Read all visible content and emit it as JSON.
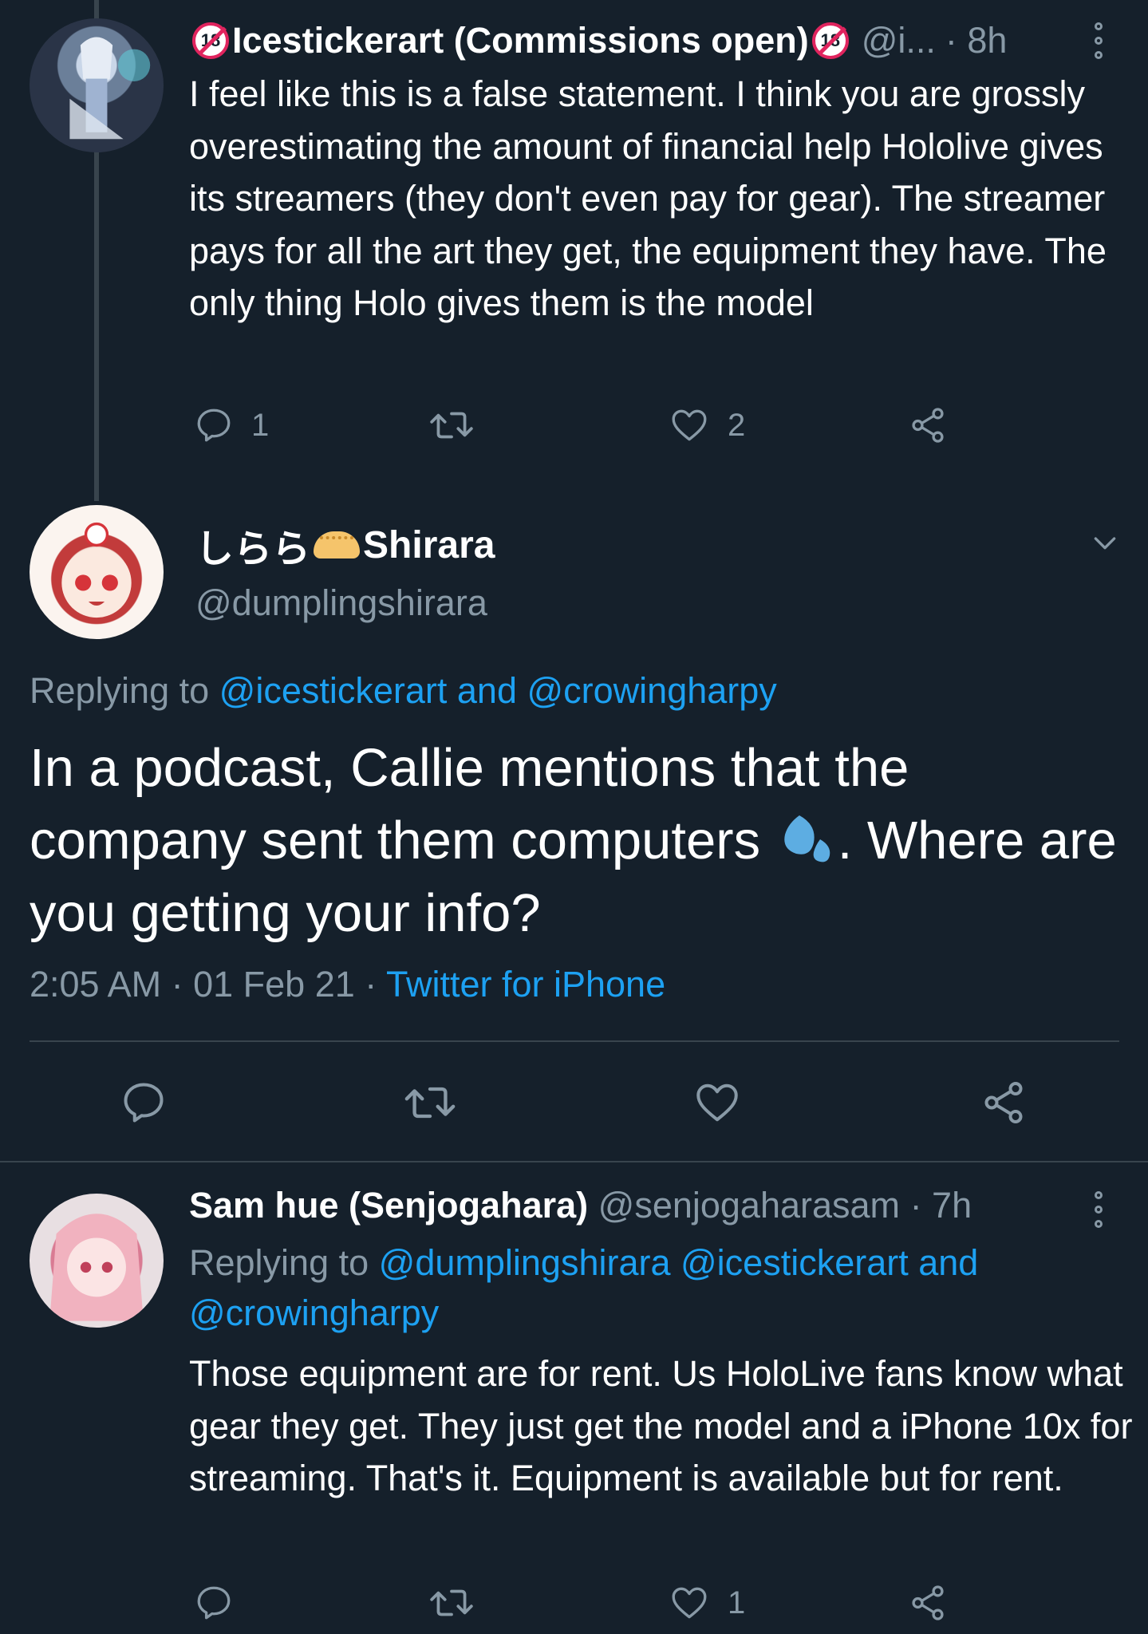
{
  "tweet1": {
    "author_name": "Icestickerart (Commissions open)",
    "badge_text": "18",
    "handle": "@i...",
    "time": "· 8h",
    "text": "I feel like this is a false statement. I think you are grossly overestimating the amount of financial help Hololive gives its streamers (they don't even pay for gear). The streamer pays for all the art they get, the equipment they have. The only thing Holo gives them is the model",
    "reply_count": "1",
    "like_count": "2"
  },
  "tweet2": {
    "author_name": "しらら",
    "author_name_suffix": "Shirara",
    "handle": "@dumplingshirara",
    "replying_prefix": "Replying to",
    "replying_to": "@icestickerart and @crowingharpy",
    "text_before_emoji": "In a podcast, Callie mentions that the company sent them computers ",
    "text_after_emoji": ". Where are you getting your info?",
    "time": "2:05 AM · 01 Feb 21 · ",
    "source": "Twitter for iPhone"
  },
  "tweet3": {
    "author_name": "Sam hue (Senjogahara)",
    "handle": "@senjogaharasam",
    "time": "· 7h",
    "replying_prefix": "Replying to",
    "replying_to": "@dumplingshirara @icestickerart and @crowingharpy",
    "text": "Those equipment are for rent. Us HoloLive fans know what gear they get. They just get the model and a iPhone 10x for streaming. That's it. Equipment is available but for rent.",
    "like_count": "1"
  },
  "colors": {
    "background": "#15202b",
    "text": "#ffffff",
    "muted": "#8899a6",
    "link": "#1da1f2",
    "divider": "#38444d"
  }
}
